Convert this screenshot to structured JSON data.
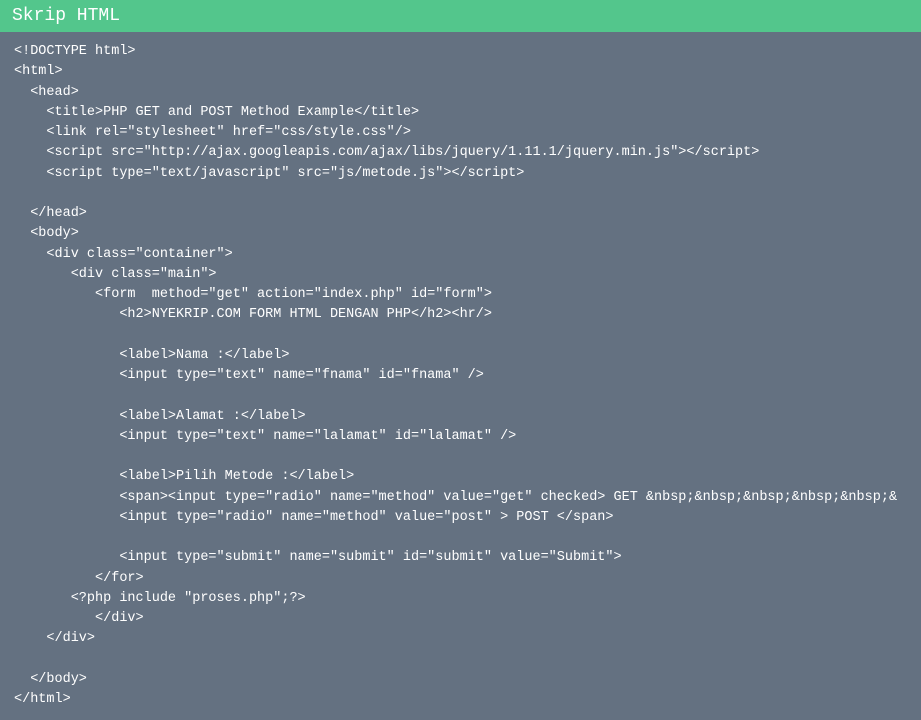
{
  "header": {
    "title": "Skrip HTML"
  },
  "code": {
    "lines": [
      "<!DOCTYPE html>",
      "<html>",
      "  <head>",
      "    <title>PHP GET and POST Method Example</title>",
      "    <link rel=\"stylesheet\" href=\"css/style.css\"/>",
      "    <script src=\"http://ajax.googleapis.com/ajax/libs/jquery/1.11.1/jquery.min.js\"></script>",
      "    <script type=\"text/javascript\" src=\"js/metode.js\"></script>",
      "",
      "  </head>",
      "  <body>",
      "    <div class=\"container\">",
      "       <div class=\"main\">",
      "          <form  method=\"get\" action=\"index.php\" id=\"form\">",
      "             <h2>NYEKRIP.COM FORM HTML DENGAN PHP</h2><hr/>",
      "",
      "             <label>Nama :</label>",
      "             <input type=\"text\" name=\"fnama\" id=\"fnama\" />",
      "",
      "             <label>Alamat :</label>",
      "             <input type=\"text\" name=\"lalamat\" id=\"lalamat\" />",
      "",
      "             <label>Pilih Metode :</label>",
      "             <span><input type=\"radio\" name=\"method\" value=\"get\" checked> GET &nbsp;&nbsp;&nbsp;&nbsp;&nbsp;&",
      "             <input type=\"radio\" name=\"method\" value=\"post\" > POST </span>",
      "",
      "             <input type=\"submit\" name=\"submit\" id=\"submit\" value=\"Submit\">",
      "          </for>",
      "       <?php include \"proses.php\";?>",
      "          </div>",
      "    </div>",
      "",
      "  </body>",
      "</html>"
    ]
  }
}
